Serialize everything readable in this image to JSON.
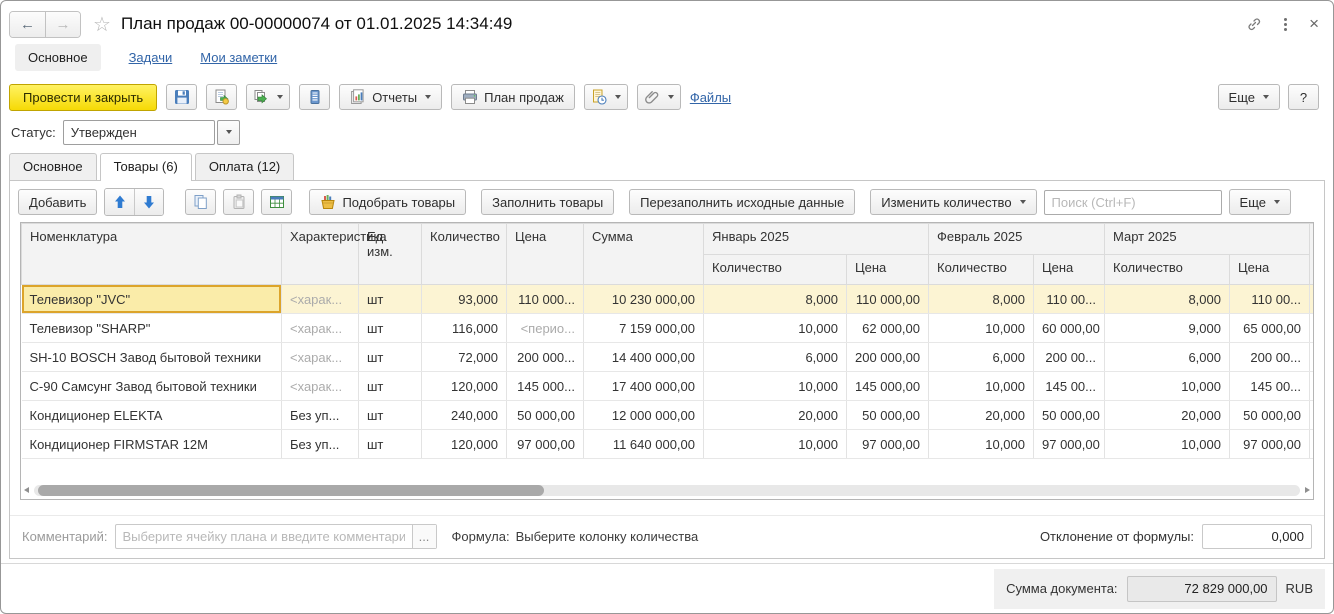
{
  "icons": {
    "back": "←",
    "forward": "→",
    "star": "☆",
    "close": "×",
    "clear": "×",
    "ellipsis": "...",
    "caret_combo": "▾",
    "help": "?"
  },
  "titlebar": {
    "title": "План продаж 00-00000074 от 01.01.2025 14:34:49"
  },
  "nav": {
    "main": "Основное",
    "tasks": "Задачи",
    "notes": "Мои заметки"
  },
  "toolbar": {
    "post_and_close": "Провести и закрыть",
    "reports": "Отчеты",
    "print_plan": "План продаж",
    "files": "Файлы",
    "more": "Еще",
    "help": "?"
  },
  "status": {
    "label": "Статус:",
    "value": "Утвержден"
  },
  "tabs": {
    "main": "Основное",
    "goods": "Товары (6)",
    "payment": "Оплата (12)"
  },
  "grid_toolbar": {
    "add": "Добавить",
    "pick_goods": "Подобрать товары",
    "fill_goods": "Заполнить товары",
    "refill_source": "Перезаполнить исходные данные",
    "change_qty": "Изменить количество",
    "search_placeholder": "Поиск (Ctrl+F)",
    "more": "Еще"
  },
  "table": {
    "columns": {
      "nomenclature": "Номенклатура",
      "characteristic": "Характеристика",
      "unit": "Ед. изм.",
      "qty": "Количество",
      "price": "Цена",
      "sum": "Сумма"
    },
    "months": [
      {
        "label": "Январь 2025",
        "qty": "Количество",
        "price": "Цена"
      },
      {
        "label": "Февраль 2025",
        "qty": "Количество",
        "price": "Цена"
      },
      {
        "label": "Март 2025",
        "qty": "Количество",
        "price": "Цена"
      }
    ],
    "rows": [
      {
        "selected": true,
        "muted": [
          "characteristic"
        ],
        "nomenclature": "Телевизор \"JVC\"",
        "characteristic": "<харак...",
        "unit": "шт",
        "qty": "93,000",
        "price": "110 000...",
        "sum": "10 230 000,00",
        "m1_qty": "8,000",
        "m1_price": "110 000,00",
        "m2_qty": "8,000",
        "m2_price": "110 00...",
        "m3_qty": "8,000",
        "m3_price": "110 00..."
      },
      {
        "muted": [
          "characteristic",
          "price"
        ],
        "nomenclature": "Телевизор \"SHARP\"",
        "characteristic": "<харак...",
        "unit": "шт",
        "qty": "116,000",
        "price": "<перио...",
        "sum": "7 159 000,00",
        "m1_qty": "10,000",
        "m1_price": "62 000,00",
        "m2_qty": "10,000",
        "m2_price": "60 000,00",
        "m3_qty": "9,000",
        "m3_price": "65 000,00"
      },
      {
        "muted": [
          "characteristic"
        ],
        "nomenclature": "SH-10 BOSCH Завод бытовой техники",
        "characteristic": "<харак...",
        "unit": "шт",
        "qty": "72,000",
        "price": "200 000...",
        "sum": "14 400 000,00",
        "m1_qty": "6,000",
        "m1_price": "200 000,00",
        "m2_qty": "6,000",
        "m2_price": "200 00...",
        "m3_qty": "6,000",
        "m3_price": "200 00..."
      },
      {
        "muted": [
          "characteristic"
        ],
        "nomenclature": "С-90 Самсунг Завод бытовой техники",
        "characteristic": "<харак...",
        "unit": "шт",
        "qty": "120,000",
        "price": "145 000...",
        "sum": "17 400 000,00",
        "m1_qty": "10,000",
        "m1_price": "145 000,00",
        "m2_qty": "10,000",
        "m2_price": "145 00...",
        "m3_qty": "10,000",
        "m3_price": "145 00..."
      },
      {
        "muted": [],
        "nomenclature": "Кондиционер ELEKTA",
        "characteristic": "Без уп...",
        "unit": "шт",
        "qty": "240,000",
        "price": "50 000,00",
        "sum": "12 000 000,00",
        "m1_qty": "20,000",
        "m1_price": "50 000,00",
        "m2_qty": "20,000",
        "m2_price": "50 000,00",
        "m3_qty": "20,000",
        "m3_price": "50 000,00"
      },
      {
        "muted": [],
        "nomenclature": "Кондиционер FIRMSTAR 12M",
        "characteristic": "Без уп...",
        "unit": "шт",
        "qty": "120,000",
        "price": "97 000,00",
        "sum": "11 640 000,00",
        "m1_qty": "10,000",
        "m1_price": "97 000,00",
        "m2_qty": "10,000",
        "m2_price": "97 000,00",
        "m3_qty": "10,000",
        "m3_price": "97 000,00"
      }
    ]
  },
  "comment": {
    "label": "Комментарий:",
    "placeholder": "Выберите ячейку плана и введите комментарий",
    "formula_label": "Формула:",
    "formula_value": "Выберите колонку количества",
    "deviation_label": "Отклонение от формулы:",
    "deviation_value": "0,000"
  },
  "footer": {
    "total_label": "Сумма документа:",
    "total_value": "72 829 000,00",
    "currency": "RUB"
  }
}
